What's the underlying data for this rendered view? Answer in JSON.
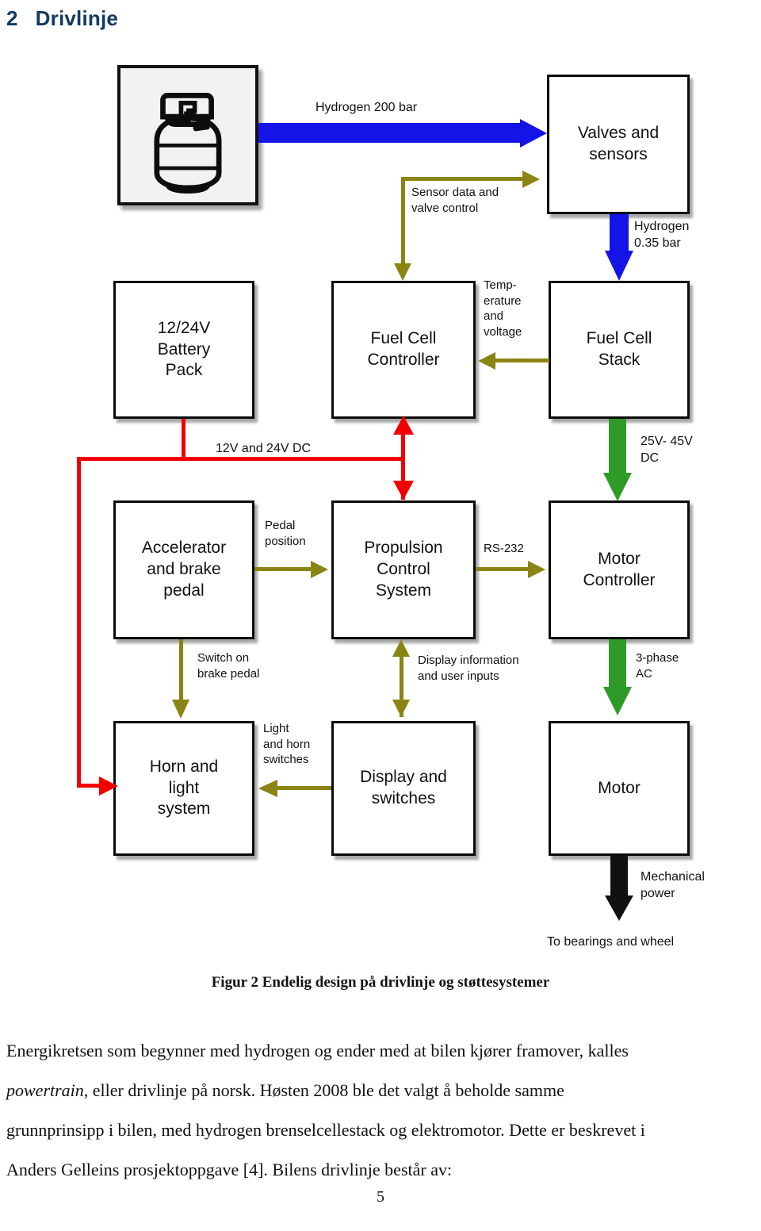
{
  "heading": {
    "number": "2",
    "title": "Drivlinje"
  },
  "figure": {
    "boxes": {
      "valves": "Valves and\nsensors",
      "battery": "12/24V\nBattery\nPack",
      "fc_controller": "Fuel Cell\nController",
      "fc_stack": "Fuel Cell\nStack",
      "pedal": "Accelerator\nand brake\npedal",
      "propulsion": "Propulsion\nControl\nSystem",
      "motor_controller": "Motor\nController",
      "horn": "Horn and\nlight\nsystem",
      "display": "Display and\nswitches",
      "motor": "Motor"
    },
    "labels": {
      "hydrogen_200": "Hydrogen 200 bar",
      "sensor_data": "Sensor data and\nvalve control",
      "hydrogen_035": "Hydrogen\n0.35 bar",
      "temp_voltage": "Temp-\nerature\nand\nvoltage",
      "dc_12_24": "12V and 24V DC",
      "dc_25_45": "25V- 45V\nDC",
      "pedal_position": "Pedal\nposition",
      "rs232": "RS-232",
      "switch_brake": "Switch on\nbrake pedal",
      "display_info": "Display information\nand user inputs",
      "three_phase": "3-phase\nAC",
      "light_horn": "Light\nand horn\nswitches",
      "mechanical_power": "Mechanical\npower",
      "to_bearings": "To bearings and wheel"
    },
    "icons": {
      "cylinder": "gas-cylinder-icon"
    },
    "colors": {
      "hydrogen": "#1414E6",
      "signal": "#8A8414",
      "lowvoltage": "#F20000",
      "highvoltage": "#2E9B28",
      "mechanical": "#111111",
      "heading": "#123A63"
    }
  },
  "caption": "Figur 2 Endelig design på drivlinje og støttesystemer",
  "body_lines": [
    "Energikretsen som begynner med hydrogen og ender med at bilen kjører framover, kalles",
    "powertrain, eller drivlinje på norsk. Høsten 2008 ble det valgt å beholde samme",
    "grunnprinsipp i bilen, med hydrogen brenselcellestack og elektromotor. Dette er beskrevet i",
    "Anders Gelleins prosjektoppgave [4]. Bilens drivlinje består av:"
  ],
  "page_number": "5"
}
